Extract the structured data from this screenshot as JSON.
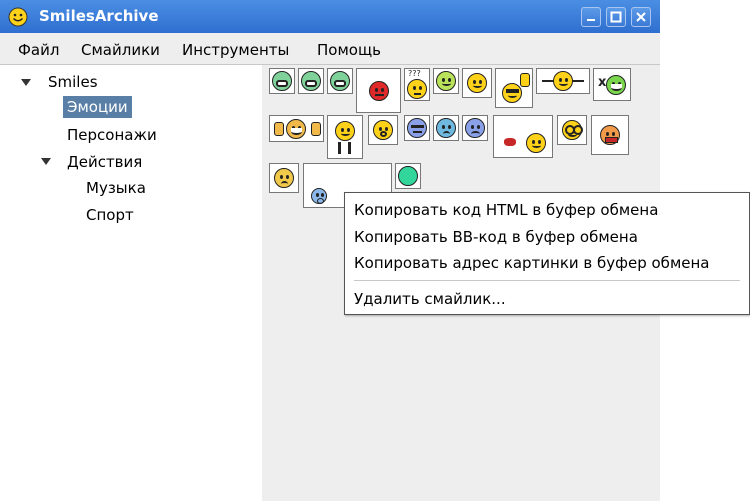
{
  "window": {
    "title": "SmilesArchive",
    "accent": "#3b79d6"
  },
  "menubar": {
    "items": [
      "Файл",
      "Смайлики",
      "Инструменты",
      "Помощь"
    ]
  },
  "tree": {
    "root": "Smiles",
    "emotions": "Эмоции",
    "characters": "Персонажи",
    "actions": "Действия",
    "music": "Музыка",
    "sport": "Спорт",
    "selected_color": "#5a7fa6"
  },
  "context_menu": {
    "copy_html": "Копировать код HTML в буфер обмена",
    "copy_bb": "Копировать BB-код в буфер обмена",
    "copy_url": "Копировать адрес картинки в буфер обмена",
    "delete": "Удалить смайлик..."
  },
  "icons": [
    "smiley-app-icon",
    "minimize-icon",
    "maximize-icon",
    "close-icon",
    "expand-arrow-icon"
  ]
}
